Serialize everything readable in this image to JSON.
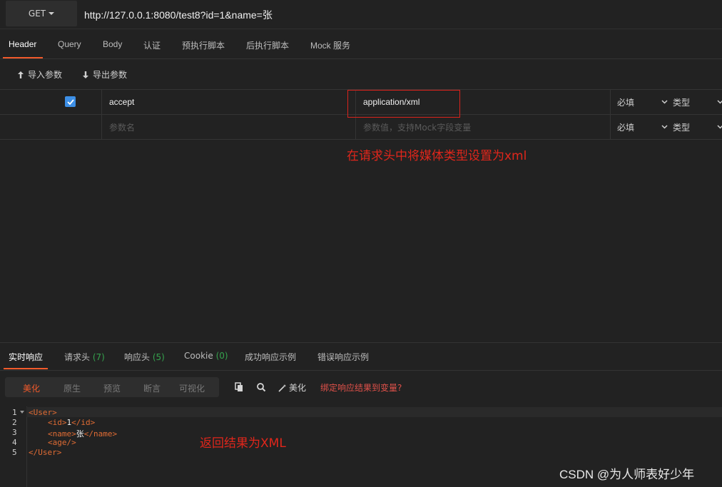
{
  "request": {
    "method": "GET",
    "url": "http://127.0.0.1:8080/test8?id=1&name=张"
  },
  "tabs": [
    "Header",
    "Query",
    "Body",
    "认证",
    "预执行脚本",
    "后执行脚本",
    "Mock 服务"
  ],
  "toolbar": {
    "import_label": "导入参数",
    "export_label": "导出参数"
  },
  "params": {
    "rows": [
      {
        "checked": true,
        "name": "accept",
        "value": "application/xml",
        "required": "必填",
        "type": "类型"
      }
    ],
    "empty_row": {
      "name_placeholder": "参数名",
      "value_placeholder": "参数值，支持Mock字段变量",
      "required": "必填",
      "type": "类型"
    }
  },
  "annotations": {
    "header_note": "在请求头中将媒体类型设置为xml",
    "result_note": "返回结果为XML"
  },
  "response": {
    "tabs": [
      {
        "label": "实时响应",
        "count": ""
      },
      {
        "label": "请求头",
        "count": "(7)"
      },
      {
        "label": "响应头",
        "count": "(5)"
      },
      {
        "label": "Cookie",
        "count": "(0)"
      },
      {
        "label": "成功响应示例",
        "count": ""
      },
      {
        "label": "错误响应示例",
        "count": ""
      }
    ],
    "view_modes": [
      "美化",
      "原生",
      "预览",
      "断言",
      "可视化"
    ],
    "beautify_label": "美化",
    "bind_link": "绑定响应结果到变量?",
    "line_numbers": [
      "1",
      "2",
      "3",
      "4",
      "5"
    ],
    "code": {
      "l1": "<User>",
      "l2_open": "<id>",
      "l2_val": "1",
      "l2_close": "</id>",
      "l3_open": "<name>",
      "l3_val": "张",
      "l3_close": "</name>",
      "l4": "<age/>",
      "l5": "</User>"
    }
  },
  "watermark": "CSDN @为人师表好少年",
  "colors": {
    "accent": "#f25a2b",
    "annotation": "#e0261b",
    "checkbox": "#3d8fe6",
    "count": "#35a34d"
  }
}
